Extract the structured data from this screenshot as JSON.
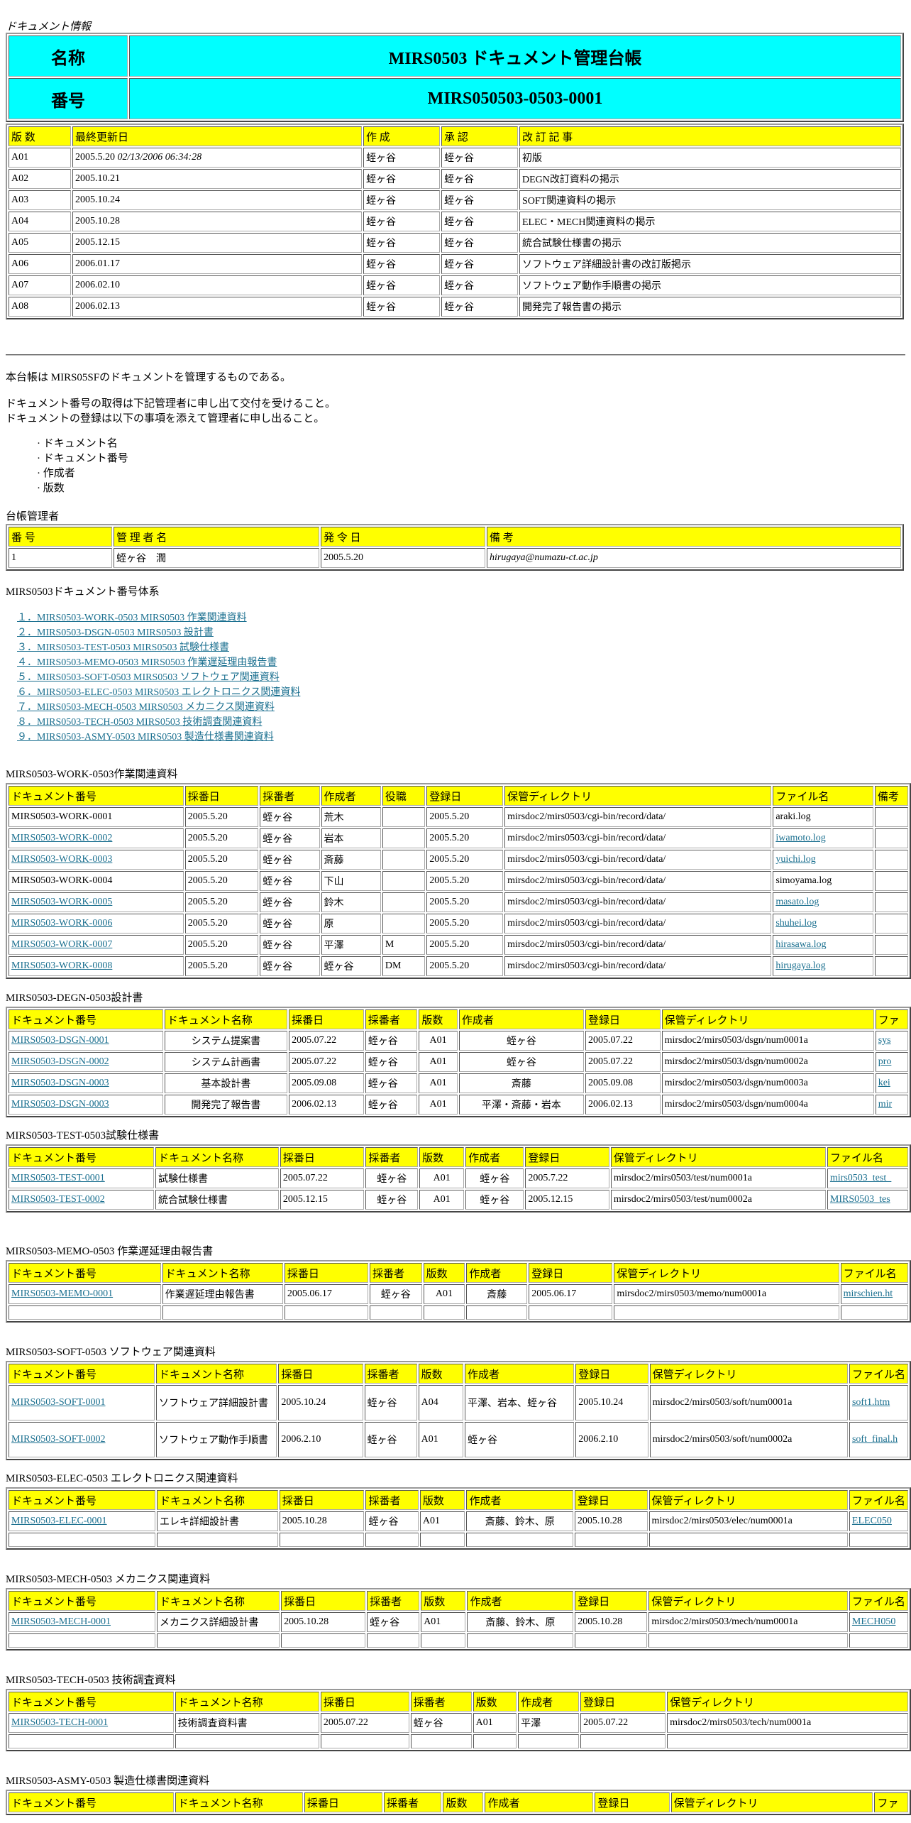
{
  "doc_info_label": "ドキュメント情報",
  "header": {
    "name_label": "名称",
    "name_value": "MIRS0503 ドキュメント管理台帳",
    "number_label": "番号",
    "number_value": "MIRS050503-0503-0001"
  },
  "revision": {
    "headers": [
      "版 数",
      "最終更新日",
      "作 成",
      "承 認",
      "改 訂 記 事"
    ],
    "rows": [
      {
        "v": "A01",
        "date": "2005.5.20",
        "date_it": "02/13/2006 06:34:28",
        "author": "蛭ヶ谷",
        "approver": "蛭ヶ谷",
        "note": "初版"
      },
      {
        "v": "A02",
        "date": "2005.10.21",
        "date_it": "",
        "author": "蛭ヶ谷",
        "approver": "蛭ヶ谷",
        "note": "DEGN改訂資料の掲示"
      },
      {
        "v": "A03",
        "date": "2005.10.24",
        "date_it": "",
        "author": "蛭ヶ谷",
        "approver": "蛭ヶ谷",
        "note": "SOFT関連資料の掲示"
      },
      {
        "v": "A04",
        "date": "2005.10.28",
        "date_it": "",
        "author": "蛭ヶ谷",
        "approver": "蛭ヶ谷",
        "note": "ELEC・MECH関連資料の掲示"
      },
      {
        "v": "A05",
        "date": "2005.12.15",
        "date_it": "",
        "author": "蛭ヶ谷",
        "approver": "蛭ヶ谷",
        "note": "統合試験仕様書の掲示"
      },
      {
        "v": "A06",
        "date": "2006.01.17",
        "date_it": "",
        "author": "蛭ヶ谷",
        "approver": "蛭ヶ谷",
        "note": "ソフトウェア詳細設計書の改訂版掲示"
      },
      {
        "v": "A07",
        "date": "2006.02.10",
        "date_it": "",
        "author": "蛭ヶ谷",
        "approver": "蛭ヶ谷",
        "note": "ソフトウェア動作手順書の掲示"
      },
      {
        "v": "A08",
        "date": "2006.02.13",
        "date_it": "",
        "author": "蛭ヶ谷",
        "approver": "蛭ヶ谷",
        "note": "開発完了報告書の掲示"
      }
    ]
  },
  "intro": {
    "p1": "本台帳は MIRS05SFのドキュメントを管理するものである。",
    "p2a": "ドキュメント番号の取得は下記管理者に申し出て交付を受けること。",
    "p2b": "ドキュメントの登録は以下の事項を添えて管理者に申し出ること。",
    "bullets": [
      "ドキュメント名",
      "ドキュメント番号",
      "作成者",
      "版数"
    ]
  },
  "managers": {
    "title": "台帳管理者",
    "headers": [
      "番 号",
      "管 理 者 名",
      "発 令 日",
      "備 考"
    ],
    "row": {
      "no": "1",
      "name": "蛭ヶ谷　潤",
      "date": "2005.5.20",
      "note": "hirugaya@numazu-ct.ac.jp"
    }
  },
  "system": {
    "title": "MIRS0503ドキュメント番号体系",
    "links": [
      "１．MIRS0503-WORK-0503 MIRS0503 作業関連資料",
      "２．MIRS0503-DSGN-0503 MIRS0503 設計書",
      "３．MIRS0503-TEST-0503 MIRS0503 試験仕様書",
      "４．MIRS0503-MEMO-0503 MIRS0503 作業遅延理由報告書",
      "５．MIRS0503-SOFT-0503 MIRS0503 ソフトウェア関連資料",
      "６．MIRS0503-ELEC-0503 MIRS0503 エレクトロニクス関連資料",
      "７．MIRS0503-MECH-0503 MIRS0503 メカニクス関連資料",
      "８．MIRS0503-TECH-0503 MIRS0503 技術調査関連資料",
      "９．MIRS0503-ASMY-0503 MIRS0503 製造仕様書関連資料"
    ]
  },
  "work": {
    "title": "MIRS0503-WORK-0503作業関連資料",
    "headers": [
      "ドキュメント番号",
      "採番日",
      "採番者",
      "作成者",
      "役職",
      "登録日",
      "保管ディレクトリ",
      "ファイル名",
      "備考"
    ],
    "rows": [
      [
        "MIRS0503-WORK-0001",
        "2005.5.20",
        "蛭ヶ谷",
        "荒木",
        "",
        "2005.5.20",
        "mirsdoc2/mirs0503/cgi-bin/record/data/",
        "araki.log",
        ""
      ],
      [
        "MIRS0503-WORK-0002",
        "2005.5.20",
        "蛭ヶ谷",
        "岩本",
        "",
        "2005.5.20",
        "mirsdoc2/mirs0503/cgi-bin/record/data/",
        "iwamoto.log",
        ""
      ],
      [
        "MIRS0503-WORK-0003",
        "2005.5.20",
        "蛭ヶ谷",
        "斎藤",
        "",
        "2005.5.20",
        "mirsdoc2/mirs0503/cgi-bin/record/data/",
        "yuichi.log",
        ""
      ],
      [
        "MIRS0503-WORK-0004",
        "2005.5.20",
        "蛭ヶ谷",
        "下山",
        "",
        "2005.5.20",
        "mirsdoc2/mirs0503/cgi-bin/record/data/",
        "simoyama.log",
        ""
      ],
      [
        "MIRS0503-WORK-0005",
        "2005.5.20",
        "蛭ヶ谷",
        "鈴木",
        "",
        "2005.5.20",
        "mirsdoc2/mirs0503/cgi-bin/record/data/",
        "masato.log",
        ""
      ],
      [
        "MIRS0503-WORK-0006",
        "2005.5.20",
        "蛭ヶ谷",
        "原",
        "",
        "2005.5.20",
        "mirsdoc2/mirs0503/cgi-bin/record/data/",
        "shuhei.log",
        ""
      ],
      [
        "MIRS0503-WORK-0007",
        "2005.5.20",
        "蛭ヶ谷",
        "平澤",
        "M",
        "2005.5.20",
        "mirsdoc2/mirs0503/cgi-bin/record/data/",
        "hirasawa.log",
        ""
      ],
      [
        "MIRS0503-WORK-0008",
        "2005.5.20",
        "蛭ヶ谷",
        "蛭ヶ谷",
        "DM",
        "2005.5.20",
        "mirsdoc2/mirs0503/cgi-bin/record/data/",
        "hirugaya.log",
        ""
      ]
    ]
  },
  "dsgn": {
    "title": "MIRS0503-DEGN-0503設計書",
    "headers": [
      "ドキュメント番号",
      "ドキュメント名称",
      "採番日",
      "採番者",
      "版数",
      "作成者",
      "登録日",
      "保管ディレクトリ",
      "ファ"
    ],
    "rows": [
      [
        "MIRS0503-DSGN-0001",
        "システム提案書",
        "2005.07.22",
        "蛭ヶ谷",
        "A01",
        "蛭ヶ谷",
        "2005.07.22",
        "mirsdoc2/mirs0503/dsgn/num0001a",
        "sys"
      ],
      [
        "MIRS0503-DSGN-0002",
        "システム計画書",
        "2005.07.22",
        "蛭ヶ谷",
        "A01",
        "蛭ヶ谷",
        "2005.07.22",
        "mirsdoc2/mirs0503/dsgn/num0002a",
        "pro"
      ],
      [
        "MIRS0503-DSGN-0003",
        "基本設計書",
        "2005.09.08",
        "蛭ヶ谷",
        "A01",
        "斎藤",
        "2005.09.08",
        "mirsdoc2/mirs0503/dsgn/num0003a",
        "kei"
      ],
      [
        "MIRS0503-DSGN-0003",
        "開発完了報告書",
        "2006.02.13",
        "蛭ヶ谷",
        "A01",
        "平澤・斎藤・岩本",
        "2006.02.13",
        "mirsdoc2/mirs0503/dsgn/num0004a",
        "mir"
      ]
    ]
  },
  "test": {
    "title": "MIRS0503-TEST-0503試験仕様書",
    "headers": [
      "ドキュメント番号",
      "ドキュメント名称",
      "採番日",
      "採番者",
      "版数",
      "作成者",
      "登録日",
      "保管ディレクトリ",
      "ファイル名"
    ],
    "rows": [
      [
        "MIRS0503-TEST-0001",
        "試験仕様書",
        "2005.07.22",
        "蛭ヶ谷",
        "A01",
        "蛭ヶ谷",
        "2005.7.22",
        "mirsdoc2/mirs0503/test/num0001a",
        "mirs0503_test_"
      ],
      [
        "MIRS0503-TEST-0002",
        "統合試験仕様書",
        "2005.12.15",
        "蛭ヶ谷",
        "A01",
        "蛭ヶ谷",
        "2005.12.15",
        "mirsdoc2/mirs0503/test/num0002a",
        "MIRS0503_tes"
      ]
    ]
  },
  "memo": {
    "title": "MIRS0503-MEMO-0503 作業遅延理由報告書",
    "headers": [
      "ドキュメント番号",
      "ドキュメント名称",
      "採番日",
      "採番者",
      "版数",
      "作成者",
      "登録日",
      "保管ディレクトリ",
      "ファイル名"
    ],
    "rows": [
      [
        "MIRS0503-MEMO-0001",
        "作業遅延理由報告書",
        "2005.06.17",
        "蛭ヶ谷",
        "A01",
        "斎藤",
        "2005.06.17",
        "mirsdoc2/mirs0503/memo/num0001a",
        "mirschien.ht"
      ]
    ]
  },
  "soft": {
    "title": "MIRS0503-SOFT-0503 ソフトウェア関連資料",
    "headers": [
      "ドキュメント番号",
      "ドキュメント名称",
      "採番日",
      "採番者",
      "版数",
      "作成者",
      "登録日",
      "保管ディレクトリ",
      "ファイル名"
    ],
    "rows": [
      [
        "MIRS0503-SOFT-0001",
        "ソフトウェア詳細設計書",
        "2005.10.24",
        "蛭ヶ谷",
        "A04",
        "平澤、岩本、蛭ヶ谷",
        "2005.10.24",
        "mirsdoc2/mirs0503/soft/num0001a",
        "soft1.htm"
      ],
      [
        "MIRS0503-SOFT-0002",
        "ソフトウェア動作手順書",
        "2006.2.10",
        "蛭ヶ谷",
        "A01",
        "蛭ヶ谷",
        "2006.2.10",
        "mirsdoc2/mirs0503/soft/num0002a",
        "soft_final.h"
      ]
    ]
  },
  "elec": {
    "title": "MIRS0503-ELEC-0503 エレクトロニクス関連資料",
    "headers": [
      "ドキュメント番号",
      "ドキュメント名称",
      "採番日",
      "採番者",
      "版数",
      "作成者",
      "登録日",
      "保管ディレクトリ",
      "ファイル名"
    ],
    "rows": [
      [
        "MIRS0503-ELEC-0001",
        "エレキ詳細設計書",
        "2005.10.28",
        "蛭ヶ谷",
        "A01",
        "斎藤、鈴木、原",
        "2005.10.28",
        "mirsdoc2/mirs0503/elec/num0001a",
        "ELEC050"
      ]
    ]
  },
  "mech": {
    "title": "MIRS0503-MECH-0503 メカニクス関連資料",
    "headers": [
      "ドキュメント番号",
      "ドキュメント名称",
      "採番日",
      "採番者",
      "版数",
      "作成者",
      "登録日",
      "保管ディレクトリ",
      "ファイル名"
    ],
    "rows": [
      [
        "MIRS0503-MECH-0001",
        "メカニクス詳細設計書",
        "2005.10.28",
        "蛭ヶ谷",
        "A01",
        "斎藤、鈴木、原",
        "2005.10.28",
        "mirsdoc2/mirs0503/mech/num0001a",
        "MECH050"
      ]
    ]
  },
  "tech": {
    "title": "MIRS0503-TECH-0503 技術調査資料",
    "headers": [
      "ドキュメント番号",
      "ドキュメント名称",
      "採番日",
      "採番者",
      "版数",
      "作成者",
      "登録日",
      "保管ディレクトリ"
    ],
    "rows": [
      [
        "MIRS0503-TECH-0001",
        "技術調査資料書",
        "2005.07.22",
        "蛭ヶ谷",
        "A01",
        "平澤",
        "2005.07.22",
        "mirsdoc2/mirs0503/tech/num0001a"
      ]
    ]
  },
  "asmy": {
    "title": "MIRS0503-ASMY-0503 製造仕様書関連資料",
    "headers": [
      "ドキュメント番号",
      "ドキュメント名称",
      "採番日",
      "採番者",
      "版数",
      "作成者",
      "登録日",
      "保管ディレクトリ",
      "ファ"
    ]
  },
  "colors": {
    "cyan": "#00ffff",
    "header_yellow": "#ffff00",
    "link": "#1a6f8f"
  }
}
